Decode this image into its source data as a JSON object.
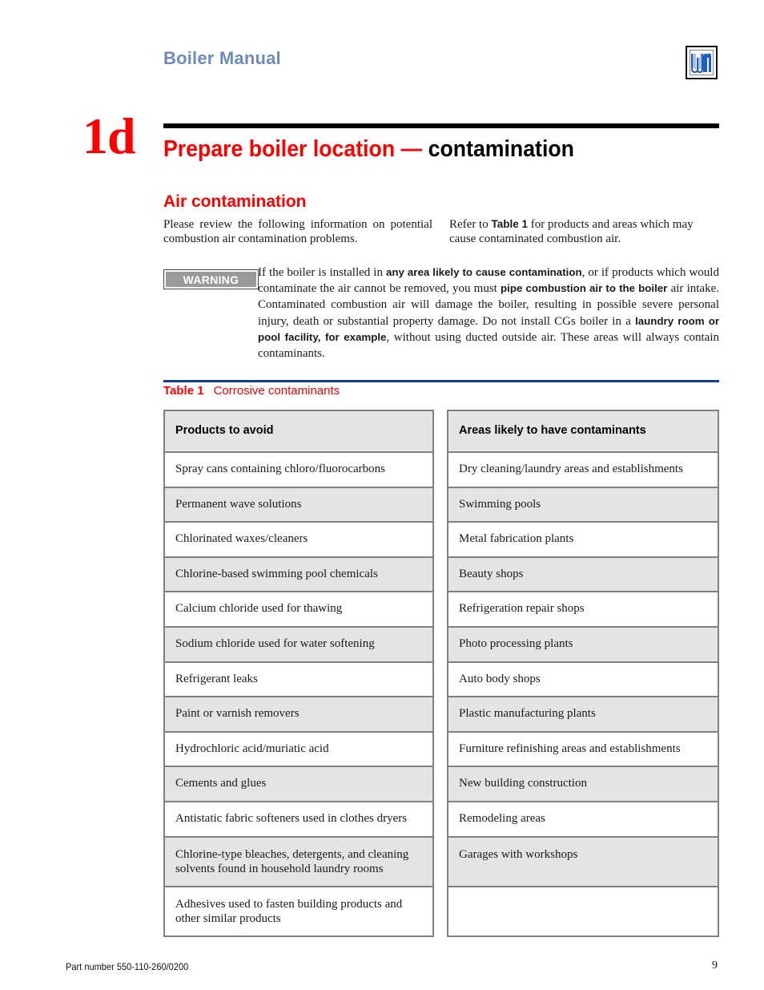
{
  "header": {
    "manual_title": "Boiler Manual",
    "logo": {
      "icon": "weil-mclain-logo-icon",
      "text": "WM",
      "color": "#1f5fbf"
    }
  },
  "chapter": {
    "number": "1d",
    "title_red": "Prepare boiler location —",
    "title_black": " contamination"
  },
  "section": {
    "heading": "Air contamination",
    "intro_left": "Please review the following information on potential combustion air contamination problems.",
    "intro_right": {
      "before": "Refer to ",
      "bold": "Table 1",
      "after": " for products and areas which may cause contaminated combustion air."
    }
  },
  "warning": {
    "badge_label": "WARNING",
    "text": [
      {
        "t": "If the boiler is installed in ",
        "b": false
      },
      {
        "t": "any area likely to cause contamination",
        "b": true
      },
      {
        "t": ", or if products which would contaminate the air cannot be removed, you must ",
        "b": false
      },
      {
        "t": "pipe combustion air to the boiler",
        "b": true
      },
      {
        "t": " air intake. Contaminated combustion air will damage the boiler, resulting in possible severe personal injury, death or substantial property damage. Do not install CGs boiler in a ",
        "b": false
      },
      {
        "t": "laundry room or pool facility, for example",
        "b": true
      },
      {
        "t": ", without using ducted outside air. These areas will always contain contaminants.",
        "b": false
      }
    ]
  },
  "table": {
    "label": "Table 1",
    "caption": "Corrosive contaminants",
    "products_header": "Products to avoid",
    "areas_header": "Areas likely to have contaminants",
    "products": [
      "Spray cans containing chloro/fluorocarbons",
      "Permanent wave solutions",
      "Chlorinated waxes/cleaners",
      "Chlorine-based swimming pool chemicals",
      "Calcium chloride used for thawing",
      "Sodium chloride used for water softening",
      "Refrigerant leaks",
      "Paint or varnish removers",
      "Hydrochloric acid/muriatic acid",
      "Cements and glues",
      "Antistatic fabric softeners used in clothes dryers",
      "Chlorine-type bleaches, detergents, and cleaning solvents found in household laundry rooms",
      "Adhesives used to fasten building products and other similar products"
    ],
    "areas": [
      "Dry cleaning/laundry areas and establishments",
      "Swimming pools",
      "Metal fabrication plants",
      "Beauty shops",
      "Refrigeration repair shops",
      "Photo processing plants",
      "Auto body shops",
      "Plastic manufacturing plants",
      "Furniture refinishing areas and establishments",
      "New building construction",
      "Remodeling areas",
      "Garages with workshops",
      ""
    ]
  },
  "footer": {
    "part_number": "Part number 550-110-260/0200",
    "page_number": "9"
  }
}
